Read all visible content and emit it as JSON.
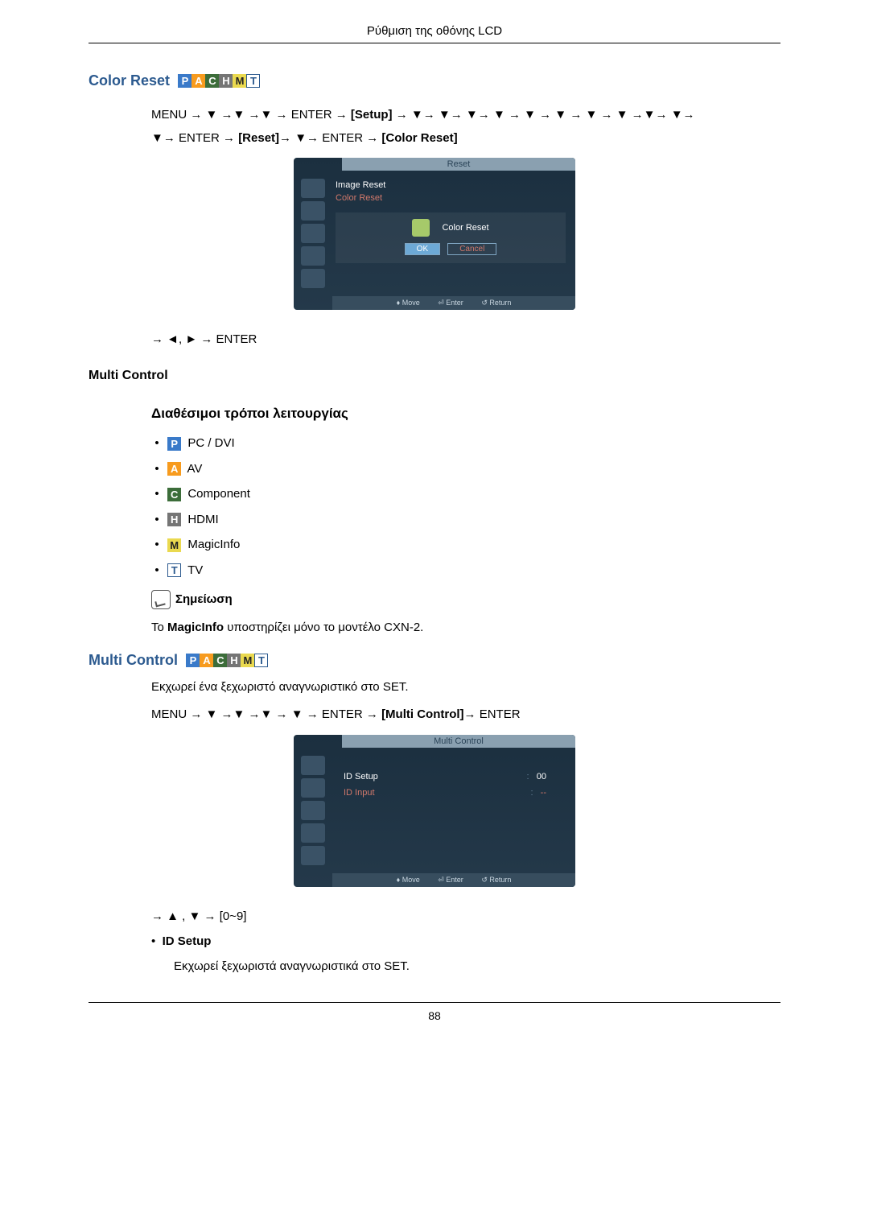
{
  "header": {
    "title": "Ρύθμιση της οθόνης LCD"
  },
  "colorReset": {
    "heading": "Color Reset",
    "badges": [
      "P",
      "A",
      "C",
      "H",
      "M",
      "T"
    ],
    "navLine1Prefix": "MENU → ▼ →▼ →▼ → ENTER → ",
    "navTag1": "[Setup]",
    "navLine1Suffix": " → ▼→ ▼→ ▼→ ▼ → ▼ → ▼ → ▼ → ▼ →▼→ ▼→",
    "navLine2Prefix": "▼→ ENTER → ",
    "navTag2": "[Reset]",
    "navLine2Mid": "→ ▼→ ENTER → ",
    "navTag3": "[Color Reset]",
    "osd": {
      "title": "Reset",
      "items": [
        "Image Reset",
        "Color Reset"
      ],
      "dialogTitle": "Color Reset",
      "ok": "OK",
      "cancel": "Cancel",
      "footerMove": "♦ Move",
      "footerEnter": "⏎ Enter",
      "footerReturn": "↺ Return"
    },
    "bottomNav": "→ ◄, ► → ENTER"
  },
  "multiControl": {
    "heading": "Multi Control",
    "modesTitle": "Διαθέσιμοι τρόποι λειτουργίας",
    "modes": [
      {
        "badge": "P",
        "label": "PC / DVI"
      },
      {
        "badge": "A",
        "label": "AV"
      },
      {
        "badge": "C",
        "label": "Component"
      },
      {
        "badge": "H",
        "label": "HDMI"
      },
      {
        "badge": "M",
        "label": "MagicInfo"
      },
      {
        "badge": "T",
        "label": "TV"
      }
    ],
    "noteLabel": "Σημείωση",
    "noteText": "Το MagicInfo υποστηρίζει μόνο το μοντέλο CXN-2.",
    "heading2": "Multi Control",
    "badges2": [
      "P",
      "A",
      "C",
      "H",
      "M",
      "T"
    ],
    "descText": "Εκχωρεί ένα ξεχωριστό αναγνωριστικό στο SET.",
    "nav2Prefix": "MENU → ▼ →▼ →▼ → ▼ → ENTER → ",
    "nav2Tag": "[Multi Control]",
    "nav2Suffix": "→ ENTER",
    "osd": {
      "title": "Multi Control",
      "rows": [
        {
          "label": "ID Setup",
          "sep": ":",
          "value": "00"
        },
        {
          "label": "ID Input",
          "sep": ":",
          "value": "--"
        }
      ],
      "footerMove": "♦ Move",
      "footerEnter": "⏎ Enter",
      "footerReturn": "↺ Return"
    },
    "bottomNav": "→ ▲ , ▼ → [0~9]",
    "bullet1": "ID Setup",
    "bullet1Desc": "Εκχωρεί ξεχωριστά αναγνωριστικά στο SET."
  },
  "pageNumber": "88"
}
